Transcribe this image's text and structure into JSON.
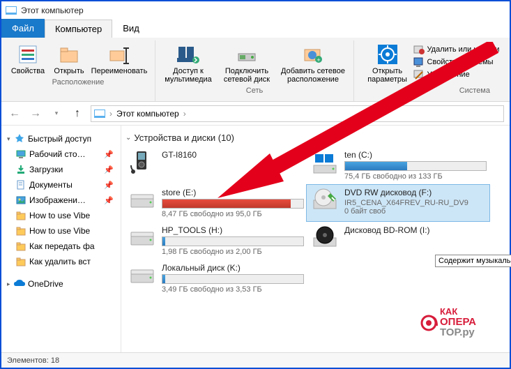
{
  "window": {
    "title": "Этот компьютер"
  },
  "tabs": {
    "file": "Файл",
    "computer": "Компьютер",
    "view": "Вид"
  },
  "ribbon": {
    "location": {
      "properties": "Свойства",
      "open": "Открыть",
      "rename": "Переименовать",
      "group_label": "Расположение"
    },
    "network": {
      "media": "Доступ к мультимедиа",
      "map": "Подключить сетевой диск",
      "addnet": "Добавить сетевое расположение",
      "group_label": "Сеть"
    },
    "system": {
      "settings": "Открыть параметры",
      "uninstall": "Удалить или измени",
      "sysprops": "Свойства системы",
      "manage": "Управление",
      "group_label": "Система"
    }
  },
  "nav": {
    "up": "↑",
    "path": "Этот компьютер",
    "sep": "›"
  },
  "sidebar": {
    "quick": "Быстрый доступ",
    "items": [
      {
        "icon": "desktop",
        "label": "Рабочий сто…",
        "pin": true
      },
      {
        "icon": "download",
        "label": "Загрузки",
        "pin": true
      },
      {
        "icon": "document",
        "label": "Документы",
        "pin": true
      },
      {
        "icon": "image",
        "label": "Изображени…",
        "pin": true
      },
      {
        "icon": "folder",
        "label": "How to use Vibe",
        "pin": false
      },
      {
        "icon": "folder",
        "label": "How to use Vibe",
        "pin": false
      },
      {
        "icon": "folder",
        "label": "Как передать фа",
        "pin": false
      },
      {
        "icon": "folder",
        "label": "Как удалить вст",
        "pin": false
      }
    ],
    "onedrive": "OneDrive"
  },
  "content": {
    "section": "Устройства и диски (10)",
    "drives": [
      {
        "icon": "mp3",
        "name": "GT-I8160",
        "bar": null,
        "free": ""
      },
      {
        "icon": "win",
        "name": "ten (C:)",
        "bar": {
          "pct": 44,
          "color": "blue"
        },
        "free": "75,4 ГБ свободно из 133 ГБ"
      },
      {
        "icon": "hdd",
        "name": "store (E:)",
        "bar": {
          "pct": 91,
          "color": "red"
        },
        "free": "8,47 ГБ свободно из 95,0 ГБ"
      },
      {
        "icon": "dvd",
        "name": "DVD RW дисковод (F:)",
        "sub": "IR5_CENA_X64FREV_RU-RU_DV9",
        "free": "0 байт своб",
        "selected": true
      },
      {
        "icon": "hdd",
        "name": "HP_TOOLS (H:)",
        "bar": {
          "pct": 2,
          "color": "blue"
        },
        "free": "1,98 ГБ свободно из 2,00 ГБ"
      },
      {
        "icon": "bd",
        "name": "Дисковод BD-ROM (I:)",
        "free": ""
      },
      {
        "icon": "hdd",
        "name": "Локальный диск (K:)",
        "bar": {
          "pct": 2,
          "color": "blue"
        },
        "free": "3,49 ГБ свободно из 3,53 ГБ"
      }
    ]
  },
  "status": {
    "count": "Элементов: 18"
  },
  "tooltip": "Содержит музыкальны",
  "watermark": {
    "line1": "КАК",
    "line2": "ОПЕРА",
    "line3": "ТОР.ру"
  }
}
